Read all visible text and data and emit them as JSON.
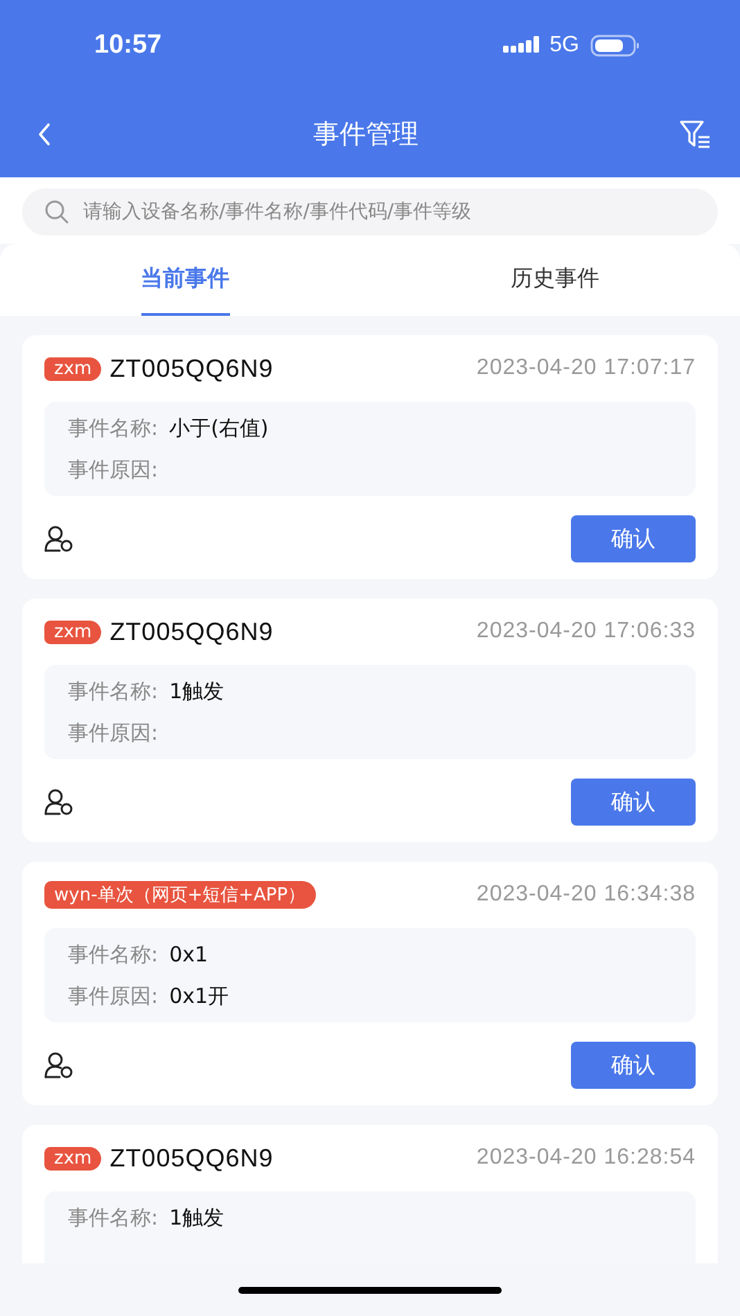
{
  "status_bar": {
    "time": "10:57",
    "network": "5G"
  },
  "nav": {
    "title": "事件管理"
  },
  "search": {
    "placeholder": "请输入设备名称/事件名称/事件代码/事件等级"
  },
  "tabs": [
    {
      "label": "当前事件",
      "selected": true
    },
    {
      "label": "历史事件",
      "selected": false
    }
  ],
  "events": [
    {
      "tag": "zxm",
      "device": "ZT005QQ6N9",
      "time": "2023-04-20 17:07:17",
      "name_label": "事件名称:",
      "name": "小于(右值)",
      "reason_label": "事件原因:",
      "button": "确认"
    },
    {
      "tag": "zxm",
      "device": "ZT005QQ6N9",
      "time": "2023-04-20 17:06:33",
      "name_label": "事件名称:",
      "name": "1触发",
      "reason_label": "事件原因:",
      "button": "确认"
    },
    {
      "tag": "wyn-单次（网页+短信+APP）",
      "time": "2023-04-20 16:34:38",
      "name_label": "事件名称:",
      "name": "0x1",
      "reason_label": "事件原因:",
      "reason": "0x1开",
      "button": "确认"
    },
    {
      "tag": "zxm",
      "device": "ZT005QQ6N9",
      "time": "2023-04-20 16:28:54",
      "name_label": "事件名称:",
      "name": "1触发"
    }
  ]
}
